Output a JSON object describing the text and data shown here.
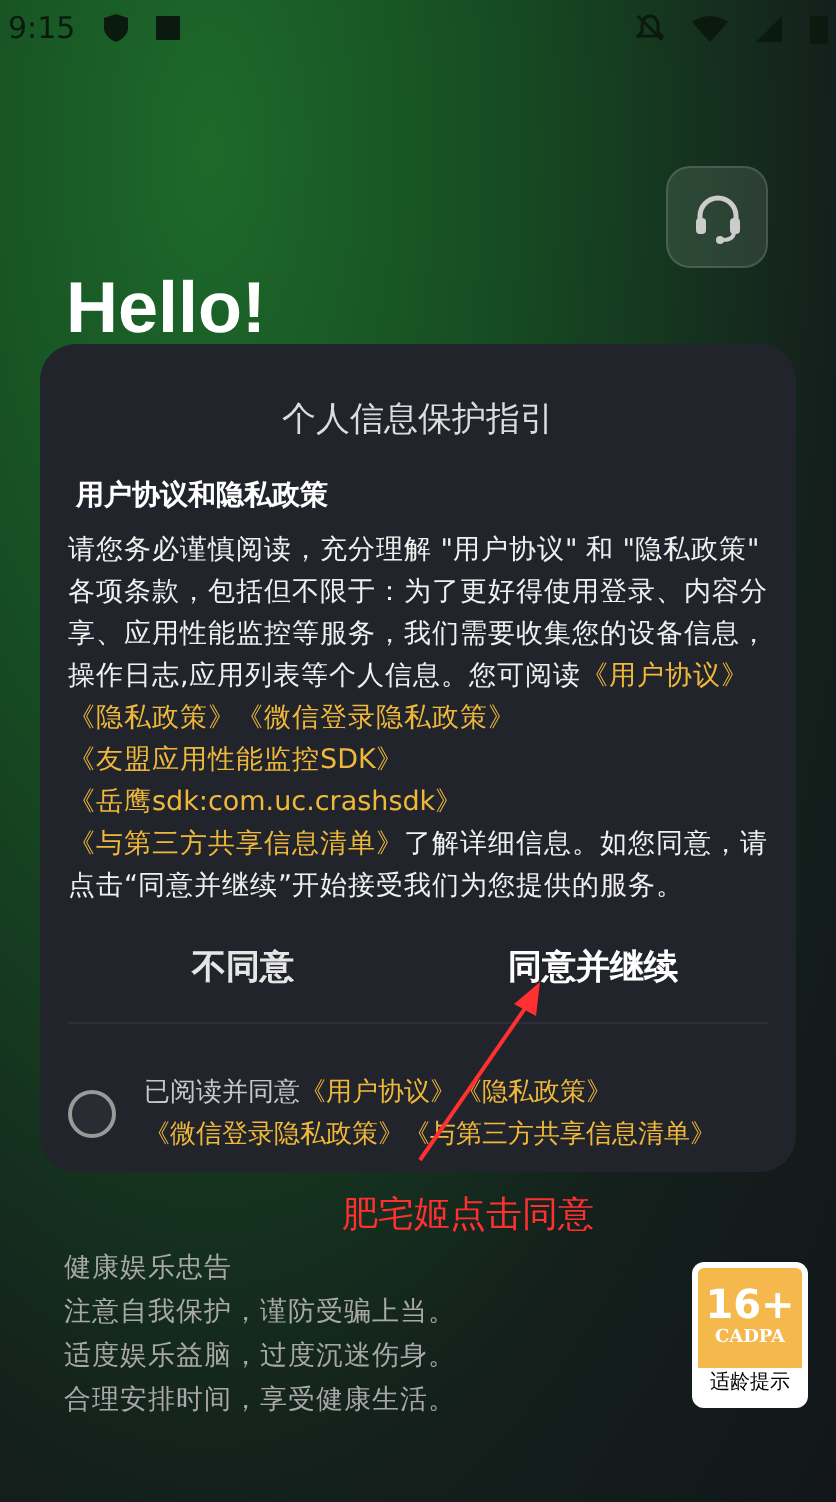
{
  "status_bar": {
    "time": "9:15"
  },
  "greeting": "Hello!",
  "dialog": {
    "title": "个人信息保护指引",
    "heading": "用户协议和隐私政策",
    "body": [
      {
        "kind": "text",
        "text": "请您务必谨慎阅读，充分理解 \"用户协议\" 和 \"隐私政策\" 各项条款，包括但不限于：为了更好得使用登录、内容分享、应用性能监控等服务，我们需要收集您的设备信息，操作日志,应用列表等个人信息。您可阅读"
      },
      {
        "kind": "link",
        "text": "《用户协议》"
      },
      {
        "kind": "link",
        "text": "《隐私政策》"
      },
      {
        "kind": "link",
        "text": "《微信登录隐私政策》"
      },
      {
        "kind": "link",
        "text": "《友盟应用性能监控SDK》"
      },
      {
        "kind": "link",
        "text": "《岳鹰sdk:com.uc.crashsdk》"
      },
      {
        "kind": "link",
        "text": "《与第三方共享信息清单》"
      },
      {
        "kind": "text",
        "text": "了解详细信息。如您同意，请点击“同意并继续”开始接受我们为您提供的服务。"
      }
    ],
    "buttons": [
      {
        "label": "不同意",
        "kind": "secondary"
      },
      {
        "label": "同意并继续",
        "kind": "primary"
      }
    ],
    "consent": {
      "checked": false,
      "segments": [
        {
          "kind": "text",
          "text": "已阅读并同意"
        },
        {
          "kind": "link",
          "text": "《用户协议》"
        },
        {
          "kind": "link",
          "text": "《隐私政策》"
        },
        {
          "kind": "link",
          "text": "《微信登录隐私政策》"
        },
        {
          "kind": "link",
          "text": "《与第三方共享信息清单》"
        }
      ]
    }
  },
  "annotation": {
    "text": "肥宅姬点击同意"
  },
  "footer": {
    "lines": [
      "健康娱乐忠告",
      "注意自我保护，谨防受骗上当。",
      "适度娱乐益脑，过度沉迷伤身。",
      "合理安排时间，享受健康生活。"
    ],
    "badge": {
      "rating": "16+",
      "org": "CADPA",
      "caption": "适龄提示"
    }
  }
}
